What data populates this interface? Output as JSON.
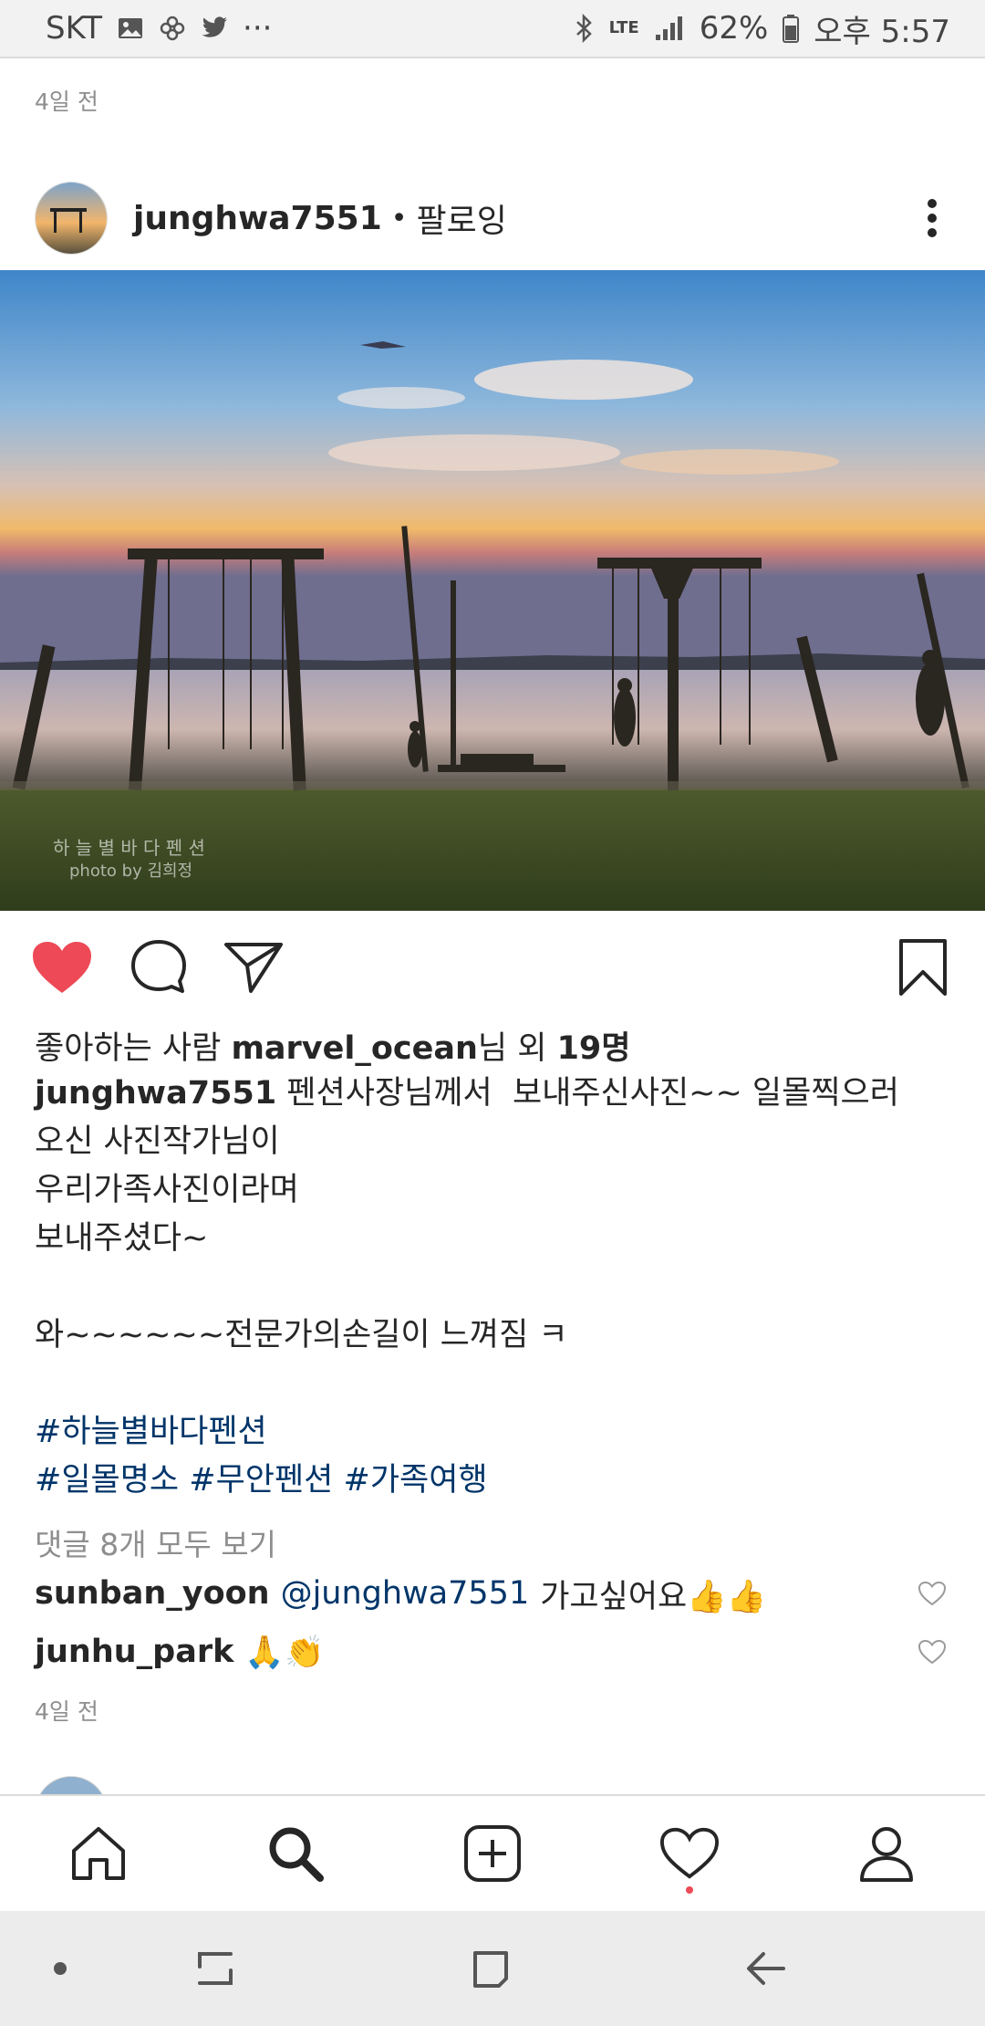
{
  "status_bar": {
    "carrier": "SKT",
    "network": "LTE",
    "battery": "62%",
    "time": "오후 5:57",
    "more": "···",
    "icons": [
      "image-icon",
      "pinwheel-icon",
      "twitter-icon",
      "bluetooth-icon",
      "signal-icon",
      "battery-icon"
    ]
  },
  "previous_post": {
    "time_ago": "4일 전"
  },
  "post": {
    "username": "junghwa7551",
    "separator": "•",
    "follow_state": "팔로잉",
    "image_watermark": {
      "line1": "하 늘 별 바 다 펜 션",
      "line2": "photo by 김희정"
    },
    "liked": true,
    "likes": {
      "prefix": "좋아하는 사람 ",
      "liker": "marvel_ocean",
      "middle": "님 외 ",
      "count": "19명"
    },
    "caption": {
      "username": "junghwa7551",
      "lines": [
        " 펜션사장님께서  보내주신사진~~ 일몰찍으러",
        "오신 사진작가님이",
        "우리가족사진이라며",
        "보내주셨다~",
        "",
        "와~~~~~~전문가의손길이 느껴짐 ㅋ",
        ""
      ],
      "hashtags_line1": "#하늘별바다펜션",
      "hashtags_line2": "#일몰명소 #무안펜션 #가족여행"
    },
    "view_comments": "댓글 8개 모두 보기",
    "comments": [
      {
        "user": "sunban_yoon",
        "mention": "@junghwa7551",
        "text": "가고싶어요👍👍"
      },
      {
        "user": "junhu_park",
        "mention": "",
        "text": "🙏👏"
      }
    ],
    "time_ago": "4일 전"
  },
  "bottom_nav": {
    "items": [
      "home",
      "search",
      "new-post",
      "activity",
      "profile"
    ],
    "active": "search",
    "activity_has_notification": true
  },
  "colors": {
    "like_red": "#ed4956",
    "hashtag_blue": "#003569",
    "secondary_gray": "#8e8e8e"
  }
}
